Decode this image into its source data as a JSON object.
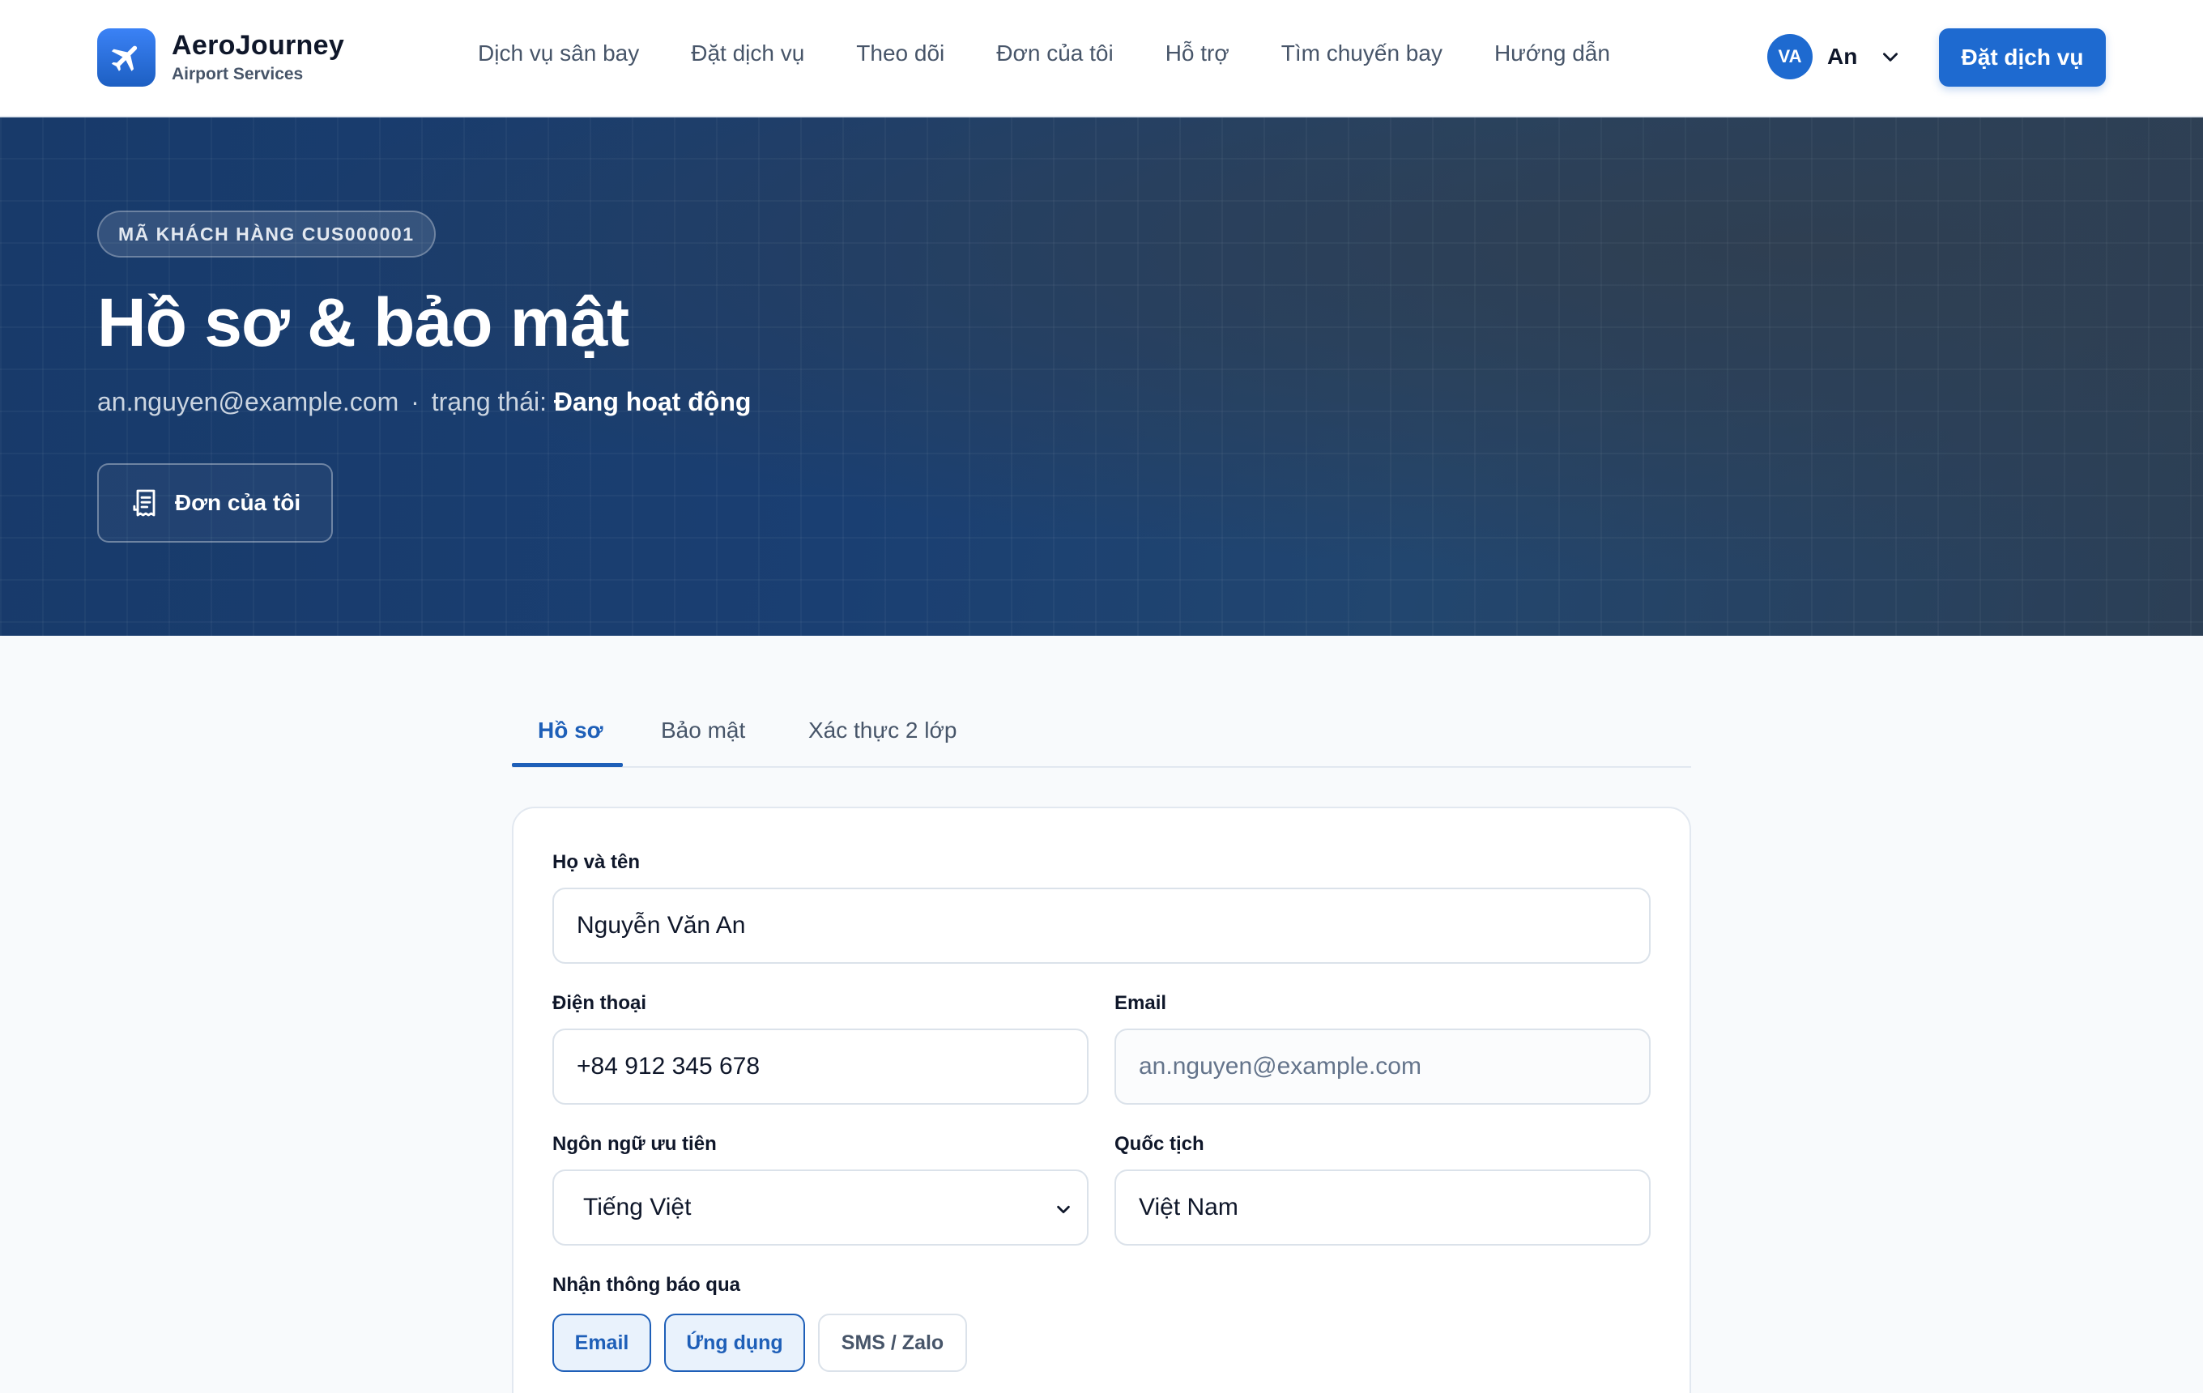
{
  "brand": {
    "name": "AeroJourney",
    "subtitle": "Airport Services"
  },
  "nav": {
    "items": [
      {
        "label": "Dịch vụ sân bay"
      },
      {
        "label": "Đặt dịch vụ"
      },
      {
        "label": "Theo dõi"
      },
      {
        "label": "Đơn của tôi"
      },
      {
        "label": "Hỗ trợ"
      },
      {
        "label": "Tìm chuyến bay"
      },
      {
        "label": "Hướng dẫn"
      }
    ]
  },
  "user": {
    "initials": "VA",
    "name": "An"
  },
  "header": {
    "cta_label": "Đặt dịch vụ"
  },
  "hero": {
    "badge": "MÃ KHÁCH HÀNG CUS000001",
    "title": "Hồ sơ & bảo mật",
    "email": "an.nguyen@example.com",
    "separator": "·",
    "status_prefix": "trạng thái:",
    "status_value": "Đang hoạt động",
    "orders_button": "Đơn của tôi"
  },
  "tabs": [
    {
      "label": "Hồ sơ",
      "active": true
    },
    {
      "label": "Bảo mật",
      "active": false
    },
    {
      "label": "Xác thực 2 lớp",
      "active": false
    }
  ],
  "form": {
    "full_name": {
      "label": "Họ và tên",
      "value": "Nguyễn Văn An"
    },
    "phone": {
      "label": "Điện thoại",
      "value": "+84 912 345 678"
    },
    "email": {
      "label": "Email",
      "value": "an.nguyen@example.com"
    },
    "language": {
      "label": "Ngôn ngữ ưu tiên",
      "value": "Tiếng Việt"
    },
    "nationality": {
      "label": "Quốc tịch",
      "value": "Việt Nam"
    },
    "notifications": {
      "label": "Nhận thông báo qua",
      "options": [
        {
          "label": "Email",
          "selected": true
        },
        {
          "label": "Ứng dụng",
          "selected": true
        },
        {
          "label": "SMS / Zalo",
          "selected": false
        }
      ]
    }
  },
  "colors": {
    "primary": "#1e6ad0",
    "hero_bg": "#183a6a",
    "active_tab": "#1e5fb8"
  }
}
